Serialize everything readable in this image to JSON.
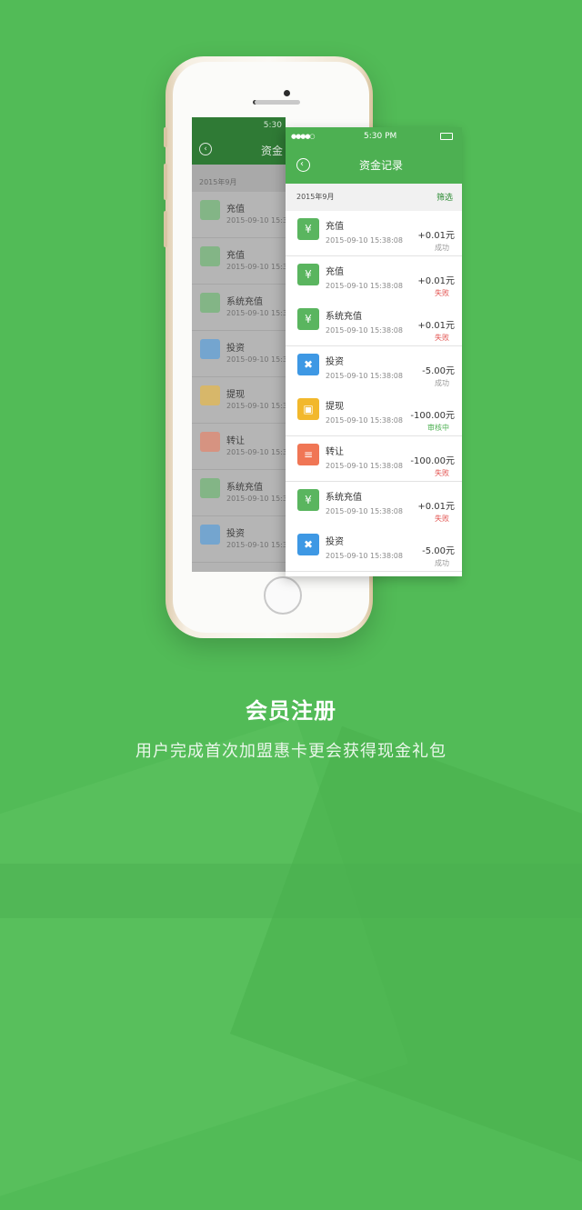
{
  "caption": {
    "headline": "会员注册",
    "subline": "用户完成首次加盟惠卡更会获得现金礼包"
  },
  "status_bar": {
    "time": "5:30 PM",
    "signal": "●●●●○"
  },
  "nav": {
    "back_glyph": "‹",
    "title": "资金记录"
  },
  "list_header": {
    "month": "2015年9月",
    "filter_label": "筛选"
  },
  "transactions": [
    {
      "label": "充值",
      "datetime": "2015-09-10 15:38:08",
      "amount": "+0.01元",
      "status": "成功",
      "status_color": "#9a9a9a",
      "icon": "money-bag-icon",
      "icon_color": "#5ab55f",
      "icon_glyph": "¥"
    },
    {
      "label": "充值",
      "datetime": "2015-09-10 15:38:08",
      "amount": "+0.01元",
      "status": "失败",
      "status_color": "#e2504d",
      "icon": "money-bag-icon",
      "icon_color": "#5ab55f",
      "icon_glyph": "¥"
    },
    {
      "label": "系统充值",
      "datetime": "2015-09-10 15:38:08",
      "amount": "+0.01元",
      "status": "失败",
      "status_color": "#e2504d",
      "icon": "money-bag-icon",
      "icon_color": "#5ab55f",
      "icon_glyph": "¥"
    },
    {
      "label": "投资",
      "datetime": "2015-09-10 15:38:08",
      "amount": "-5.00元",
      "status": "成功",
      "status_color": "#9a9a9a",
      "icon": "ticket-icon",
      "icon_color": "#3e98e4",
      "icon_glyph": "✖"
    },
    {
      "label": "提现",
      "datetime": "2015-09-10 15:38:08",
      "amount": "-100.00元",
      "status": "审核中",
      "status_color": "#4db052",
      "icon": "wallet-icon",
      "icon_color": "#f2b82c",
      "icon_glyph": "▣"
    },
    {
      "label": "转让",
      "datetime": "2015-09-10 15:38:08",
      "amount": "-100.00元",
      "status": "失败",
      "status_color": "#e2504d",
      "icon": "transfer-icon",
      "icon_color": "#f07655",
      "icon_glyph": "≡"
    },
    {
      "label": "系统充值",
      "datetime": "2015-09-10 15:38:08",
      "amount": "+0.01元",
      "status": "失败",
      "status_color": "#e2504d",
      "icon": "money-bag-icon",
      "icon_color": "#5ab55f",
      "icon_glyph": "¥"
    },
    {
      "label": "投资",
      "datetime": "2015-09-10 15:38:08",
      "amount": "-5.00元",
      "status": "成功",
      "status_color": "#9a9a9a",
      "icon": "ticket-icon",
      "icon_color": "#3e98e4",
      "icon_glyph": "✖"
    }
  ],
  "phone_screen": {
    "time": "5:30",
    "title": "资金",
    "datetime": "2015-09-10 15:38:0"
  },
  "colors": {
    "brand_green": "#4db052",
    "background": "#52bb57"
  }
}
